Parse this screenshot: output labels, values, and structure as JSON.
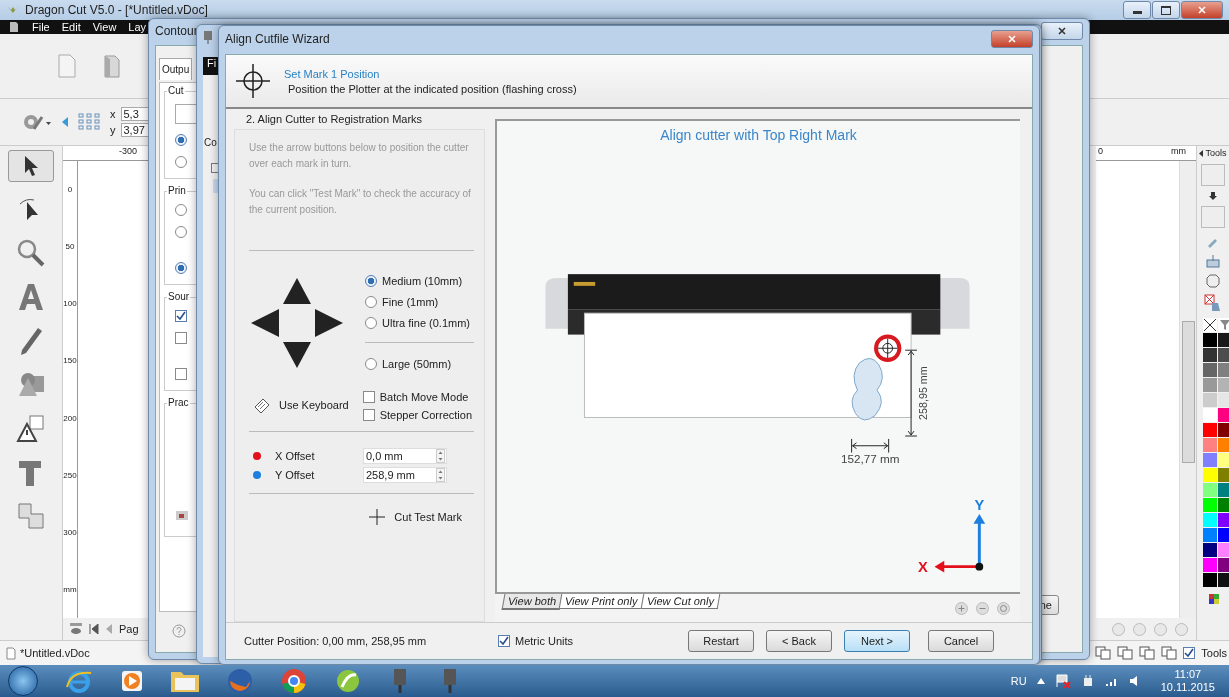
{
  "main_window": {
    "title": "Dragon Cut V5.0 - [*Untitled.vDoc]",
    "menu": [
      "File",
      "Edit",
      "View",
      "Lay"
    ],
    "coords": [
      {
        "label": "x",
        "value": "5,3"
      },
      {
        "label": "y",
        "value": "3,97"
      }
    ],
    "top_ruler": "-300",
    "left_ruler": [
      "0",
      "50",
      "100",
      "150",
      "200",
      "250",
      "300",
      "mm"
    ],
    "right_ruler": [
      "0",
      "mm"
    ],
    "tools_tab": "Tools",
    "page_nav": "Pag",
    "status_doc": "*Untitled.vDoc",
    "tools_toggle": {
      "label": "Tools",
      "checked": true
    },
    "palette": [
      {
        "color": "#000000"
      },
      {
        "color": "#1a1a1a"
      },
      {
        "color": "#333333"
      },
      {
        "color": "#4d4d4d"
      },
      {
        "color": "#666666"
      },
      {
        "color": "#808080"
      },
      {
        "color": "#999999"
      },
      {
        "color": "#b3b3b3"
      },
      {
        "color": "#cccccc"
      },
      {
        "color": "#e6e6e6"
      },
      {
        "color": "#ffffff"
      },
      {
        "color": "#ff0080"
      },
      {
        "color": "#ff0000"
      },
      {
        "color": "#800000"
      },
      {
        "color": "#ff8080"
      },
      {
        "color": "#ff8000"
      },
      {
        "color": "#8080ff"
      },
      {
        "color": "#ffff80"
      },
      {
        "color": "#ffff00"
      },
      {
        "color": "#808000"
      },
      {
        "color": "#80ff80"
      },
      {
        "color": "#008080"
      },
      {
        "color": "#00ff00"
      },
      {
        "color": "#008000"
      },
      {
        "color": "#00ffff"
      },
      {
        "color": "#8000ff"
      },
      {
        "color": "#0080ff"
      },
      {
        "color": "#0000ff"
      },
      {
        "color": "#000080"
      },
      {
        "color": "#ff80ff"
      },
      {
        "color": "#ff00ff"
      },
      {
        "color": "#800080"
      },
      {
        "color": "#000000"
      },
      {
        "color": "#111111"
      }
    ]
  },
  "contour_window": {
    "title": "Contour",
    "tab": "Outpu",
    "groups": [
      "Cut",
      "Prin",
      "Sour",
      "Prac"
    ],
    "cut_radios": [
      {
        "selected": true
      },
      {
        "selected": false
      }
    ],
    "print_radios": [
      {
        "selected": false
      },
      {
        "selected": false
      },
      {
        "selected": true
      }
    ],
    "source_checks": [
      {
        "checked": true
      },
      {
        "checked": false
      },
      {
        "checked": false
      }
    ],
    "button": "ne"
  },
  "file_window": {
    "menu": "Fi",
    "tab": "Co"
  },
  "wizard": {
    "title": "Align Cutfile Wizard",
    "step_title": "Set Mark 1 Position",
    "step_subtitle": "Position the Plotter at the indicated position (flashing cross)",
    "group_title": "2. Align Cutter to Registration Marks",
    "instructions": [
      "Use the arrow buttons below to position the cutter over each mark in turn.",
      "You can click \"Test Mark\" to check the accuracy of the current position."
    ],
    "step_sizes": [
      {
        "label": "Medium (10mm)",
        "selected": true
      },
      {
        "label": "Fine (1mm)",
        "selected": false
      },
      {
        "label": "Ultra fine (0.1mm)",
        "selected": false
      }
    ],
    "large_step": {
      "label": "Large (50mm)",
      "selected": false
    },
    "keyboard_button": "Use Keyboard",
    "options": [
      {
        "label": "Batch Move Mode",
        "checked": false
      },
      {
        "label": "Stepper Correction",
        "checked": false
      }
    ],
    "offsets": [
      {
        "label": "X Offset",
        "color": "#e3101c",
        "value": "0,0 mm"
      },
      {
        "label": "Y Offset",
        "color": "#1c7fe0",
        "value": "258,9 mm"
      }
    ],
    "test_button": "Cut Test Mark",
    "preview": {
      "title": "Align cutter with Top Right Mark",
      "height_label": "258,95 mm",
      "width_label": "152,77 mm",
      "y_axis": "Y",
      "x_axis": "X"
    },
    "view_tabs": [
      {
        "label": "View both",
        "selected": true
      },
      {
        "label": "View Print only",
        "selected": false
      },
      {
        "label": "View Cut only",
        "selected": false
      }
    ],
    "cutter_position": "Cutter Position: 0,00 mm, 258,95 mm",
    "metric": {
      "label": "Metric Units",
      "checked": true
    },
    "buttons": [
      {
        "label": "Restart",
        "kind": "normal"
      },
      {
        "label": "< Back",
        "kind": "normal"
      },
      {
        "label": "Next >",
        "kind": "default"
      },
      {
        "label": "Cancel",
        "kind": "normal"
      }
    ]
  },
  "taskbar": {
    "language": "RU",
    "time": "11:07",
    "date": "10.11.2015"
  }
}
